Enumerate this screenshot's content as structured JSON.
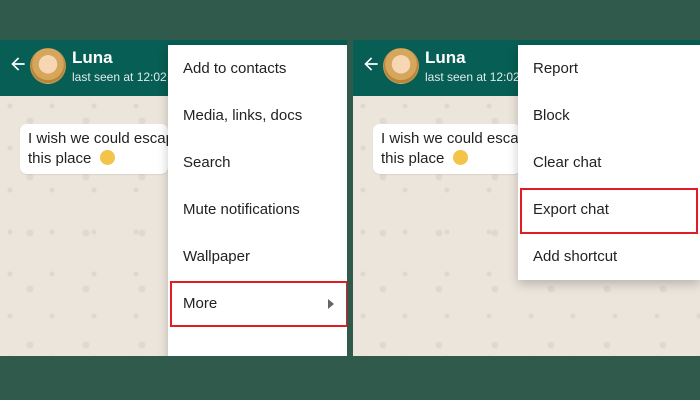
{
  "contact": {
    "name": "Luna",
    "last_seen": "last seen at 12:02"
  },
  "message": {
    "line1": "I wish we could escape",
    "line2": "this place",
    "emoji_icon": "smiling-face-with-sweat-emoji"
  },
  "left_menu": {
    "items": [
      "Add to contacts",
      "Media, links, docs",
      "Search",
      "Mute notifications",
      "Wallpaper",
      "More"
    ],
    "highlighted": "More"
  },
  "right_menu": {
    "items": [
      "Report",
      "Block",
      "Clear chat",
      "Export chat",
      "Add shortcut"
    ],
    "highlighted": "Export chat"
  },
  "colors": {
    "page_background": "#2f5a4c",
    "header_bg": "#075e54",
    "chat_bg": "#ece5dc",
    "highlight": "#e31b23"
  }
}
